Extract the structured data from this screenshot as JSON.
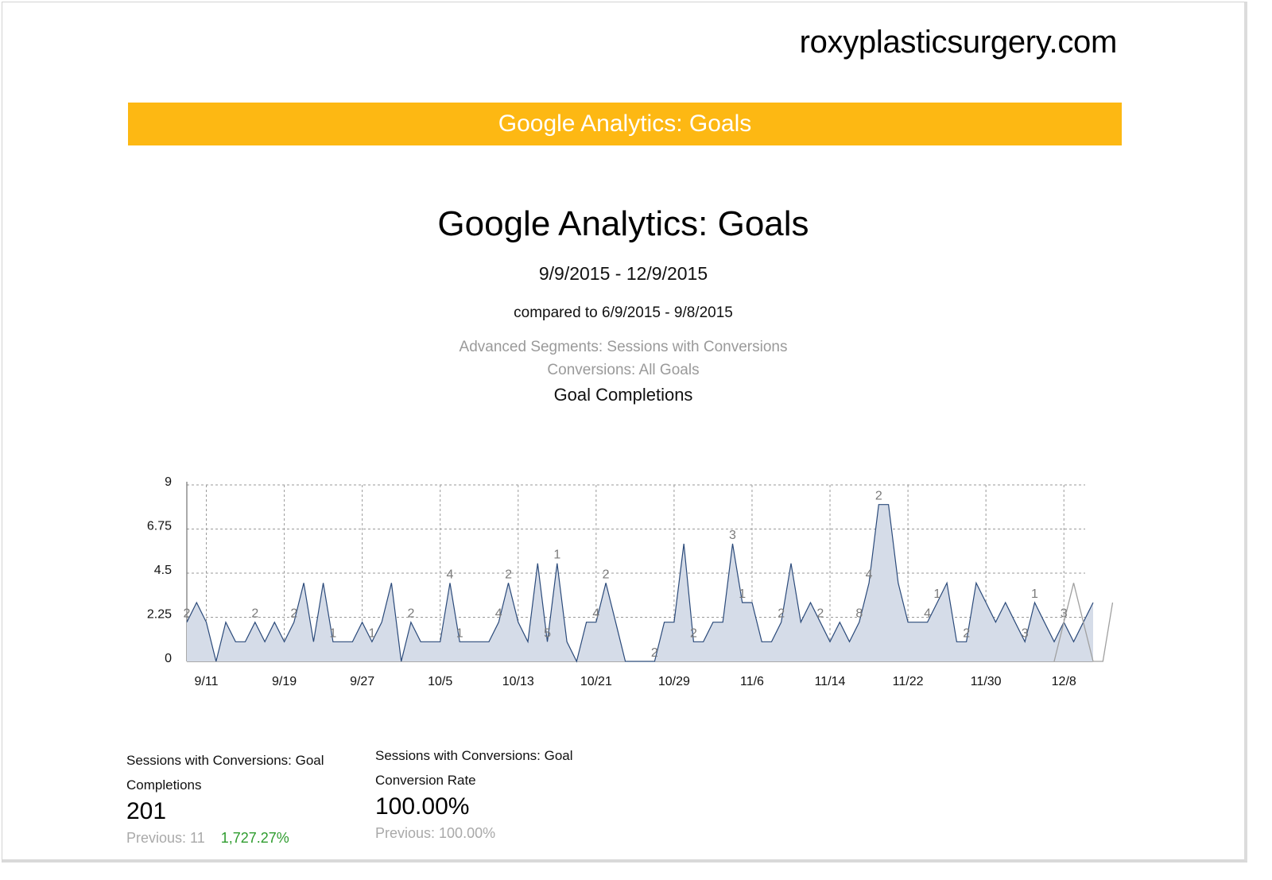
{
  "site": {
    "name": "roxyplasticsurgery.com"
  },
  "banner": {
    "title": "Google Analytics: Goals"
  },
  "report": {
    "title": "Google Analytics: Goals",
    "date_range": "9/9/2015 - 12/9/2015",
    "compared_to": "compared to 6/9/2015 - 9/8/2015",
    "segments": "Advanced Segments: Sessions with Conversions",
    "conversions": "Conversions: All Goals",
    "chart_title": "Goal Completions"
  },
  "colors": {
    "banner": "#fdb813",
    "series_current_fill": "#d5dce8",
    "series_current_line": "#2b4a7a",
    "series_previous_line": "#a0a0a0",
    "positive_change": "#2e9c2e"
  },
  "chart_data": {
    "type": "area",
    "title": "Goal Completions",
    "xlabel": "",
    "ylabel": "",
    "ylim": [
      0,
      9
    ],
    "yticks": [
      "0",
      "2.25",
      "4.5",
      "6.75",
      "9"
    ],
    "xticks": [
      "9/11",
      "9/19",
      "9/27",
      "10/5",
      "10/13",
      "10/21",
      "10/29",
      "11/6",
      "11/14",
      "11/22",
      "11/30",
      "12/8"
    ],
    "grid": true,
    "legend": "none",
    "x_start": "9/9/2015",
    "series": [
      {
        "role": "current",
        "values": [
          2,
          3,
          2,
          0,
          2,
          1,
          1,
          2,
          1,
          2,
          1,
          2,
          4,
          1,
          4,
          1,
          1,
          1,
          2,
          1,
          2,
          4,
          0,
          2,
          1,
          1,
          1,
          4,
          1,
          1,
          1,
          1,
          2,
          4,
          2,
          1,
          5,
          1,
          5,
          1,
          0,
          2,
          2,
          4,
          2,
          0,
          0,
          0,
          0,
          2,
          2,
          6,
          1,
          1,
          2,
          2,
          6,
          3,
          3,
          1,
          1,
          2,
          5,
          2,
          3,
          2,
          1,
          2,
          1,
          2,
          4,
          8,
          8,
          4,
          2,
          2,
          2,
          3,
          4,
          1,
          1,
          4,
          3,
          2,
          3,
          2,
          1,
          3,
          2,
          1,
          2,
          1,
          2,
          3
        ]
      },
      {
        "role": "previous",
        "values": [
          0,
          0,
          0,
          0,
          0,
          0,
          0,
          0,
          0,
          0,
          0,
          0,
          0,
          0,
          0,
          0,
          0,
          0,
          0,
          0,
          0,
          0,
          0,
          0,
          0,
          0,
          0,
          0,
          0,
          0,
          0,
          0,
          0,
          0,
          0,
          0,
          0,
          0,
          0,
          0,
          0,
          0,
          0,
          0,
          0,
          0,
          0,
          0,
          0,
          0,
          0,
          0,
          0,
          0,
          0,
          0,
          0,
          0,
          0,
          0,
          0,
          0,
          0,
          0,
          0,
          0,
          0,
          0,
          0,
          0,
          0,
          0,
          0,
          0,
          0,
          0,
          0,
          0,
          0,
          0,
          0,
          0,
          0,
          0,
          0,
          0,
          0,
          0,
          0,
          0,
          2,
          4,
          2,
          0,
          0,
          3
        ]
      }
    ],
    "data_labels": [
      {
        "x": 0,
        "label": "2"
      },
      {
        "x": 7,
        "label": "2"
      },
      {
        "x": 11,
        "label": "2"
      },
      {
        "x": 15,
        "label": "1"
      },
      {
        "x": 19,
        "label": "1"
      },
      {
        "x": 23,
        "label": "2"
      },
      {
        "x": 27,
        "label": "4"
      },
      {
        "x": 28,
        "label": "1"
      },
      {
        "x": 32,
        "label": "4"
      },
      {
        "x": 33,
        "label": "2"
      },
      {
        "x": 37,
        "label": "5"
      },
      {
        "x": 38,
        "label": "1"
      },
      {
        "x": 42,
        "label": "4"
      },
      {
        "x": 43,
        "label": "2"
      },
      {
        "x": 48,
        "label": "2"
      },
      {
        "x": 52,
        "label": "2"
      },
      {
        "x": 56,
        "label": "3"
      },
      {
        "x": 57,
        "label": "1"
      },
      {
        "x": 61,
        "label": "2"
      },
      {
        "x": 65,
        "label": "2"
      },
      {
        "x": 69,
        "label": "8"
      },
      {
        "x": 70,
        "label": "4"
      },
      {
        "x": 71,
        "label": "2"
      },
      {
        "x": 76,
        "label": "4"
      },
      {
        "x": 77,
        "label": "1"
      },
      {
        "x": 80,
        "label": "2"
      },
      {
        "x": 86,
        "label": "3"
      },
      {
        "x": 87,
        "label": "1"
      },
      {
        "x": 90,
        "label": "3"
      }
    ]
  },
  "metrics": [
    {
      "label": "Sessions with Conversions: Goal Completions",
      "value": "201",
      "previous": "Previous: 11",
      "change": "1,727.27%"
    },
    {
      "label": "Sessions with Conversions: Goal Conversion Rate",
      "value": "100.00%",
      "previous": "Previous: 100.00%",
      "change": ""
    }
  ]
}
